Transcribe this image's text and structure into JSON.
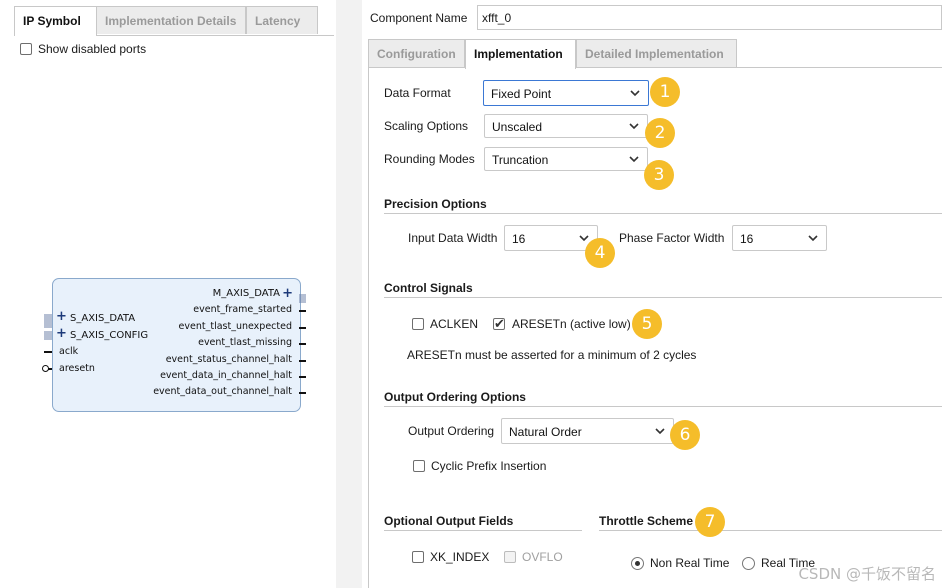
{
  "left_panel": {
    "tabs": [
      "IP Symbol",
      "Implementation Details",
      "Latency"
    ],
    "show_disabled_ports": "Show disabled ports",
    "symbol": {
      "left_ports": [
        "S_AXIS_DATA",
        "S_AXIS_CONFIG",
        "aclk",
        "aresetn"
      ],
      "right_ports": [
        "M_AXIS_DATA",
        "event_frame_started",
        "event_tlast_unexpected",
        "event_tlast_missing",
        "event_status_channel_halt",
        "event_data_in_channel_halt",
        "event_data_out_channel_halt"
      ]
    }
  },
  "component": {
    "label": "Component Name",
    "value": "xfft_0"
  },
  "right_tabs": [
    "Configuration",
    "Implementation",
    "Detailed Implementation"
  ],
  "fields": {
    "data_format": {
      "label": "Data Format",
      "value": "Fixed Point"
    },
    "scaling": {
      "label": "Scaling Options",
      "value": "Unscaled"
    },
    "rounding": {
      "label": "Rounding Modes",
      "value": "Truncation"
    }
  },
  "precision": {
    "title": "Precision Options",
    "input_width_label": "Input Data Width",
    "input_width": "16",
    "phase_width_label": "Phase Factor Width",
    "phase_width": "16"
  },
  "control": {
    "title": "Control Signals",
    "aclken": "ACLKEN",
    "aresetn": "ARESETn (active low)",
    "note": "ARESETn must be asserted for a minimum of 2 cycles"
  },
  "ordering": {
    "title": "Output Ordering Options",
    "label": "Output Ordering",
    "value": "Natural Order",
    "cyclic": "Cyclic Prefix Insertion"
  },
  "optional": {
    "title": "Optional Output Fields",
    "xk_index": "XK_INDEX",
    "ovflo": "OVFLO"
  },
  "throttle": {
    "title": "Throttle Scheme",
    "non_real_time": "Non Real Time",
    "real_time": "Real Time"
  },
  "badges": [
    "1",
    "2",
    "3",
    "4",
    "5",
    "6",
    "7"
  ],
  "watermark": "CSDN @千饭不留名",
  "colors": {
    "badge": "#f5bd2a",
    "focus": "#3b78d4",
    "block_fill": "#e8f1fb"
  }
}
